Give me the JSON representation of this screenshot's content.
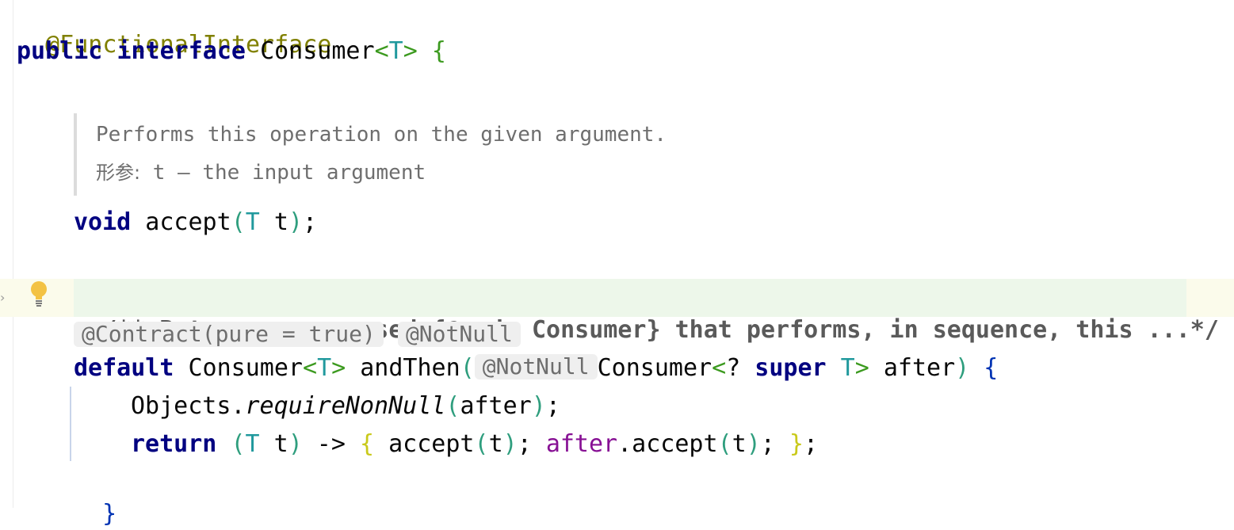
{
  "code": {
    "annotation_line": "@FunctionalInterface",
    "decl": {
      "public": "public",
      "interface": "interface",
      "name": "Consumer",
      "lt": "<",
      "T": "T",
      "gt": ">",
      "brace": "{"
    },
    "doc": {
      "line1": "Performs this operation on the given argument.",
      "param_label": "形参:",
      "line2": " t – the input argument"
    },
    "accept_decl": {
      "void": "void",
      "name": " accept",
      "lp": "(",
      "T": "T",
      "arg": " t",
      "rp": ")",
      "semi": ";"
    },
    "collapsed_doc": "/** Returns a composed {@code Consumer} that performs, in sequence, this ...*/",
    "inlay_annotations": {
      "contract": "@Contract(pure = true)",
      "notnull": "@NotNull"
    },
    "andthen_decl": {
      "default": "default",
      "type": " Consumer",
      "lt": "<",
      "T": "T",
      "gt": ">",
      "name": " andThen",
      "lp": "(",
      "notnull": "@NotNull",
      "ptype": "Consumer",
      "plt": "<",
      "q": "? ",
      "super": "super",
      "pT": " T",
      "pgt": ">",
      "pname": " after",
      "rp": ")",
      "brace": " {"
    },
    "body1": {
      "obj": "Objects.",
      "method": "requireNonNull",
      "lp": "(",
      "arg": "after",
      "rp": ")",
      "semi": ";"
    },
    "body2": {
      "return": "return",
      "sp": " ",
      "lp": "(",
      "T": "T",
      "t": " t",
      "rp": ")",
      "arrow": " -> ",
      "lb": "{",
      "call1": " accept",
      "lp2": "(",
      "t2": "t",
      "rp2": ")",
      "semi1": "; ",
      "after": "after",
      "call2": ".accept",
      "lp3": "(",
      "t3": "t",
      "rp3": ")",
      "semi2": "; ",
      "rb": "}",
      "semi3": ";"
    },
    "close_brace": "}"
  },
  "icons": {
    "bulb": "lightbulb-icon",
    "fold": "fold-arrow-icon"
  },
  "colors": {
    "keyword": "#000080",
    "annotation": "#808000",
    "type_param": "#20999d",
    "highlight": "#edf7ea"
  }
}
